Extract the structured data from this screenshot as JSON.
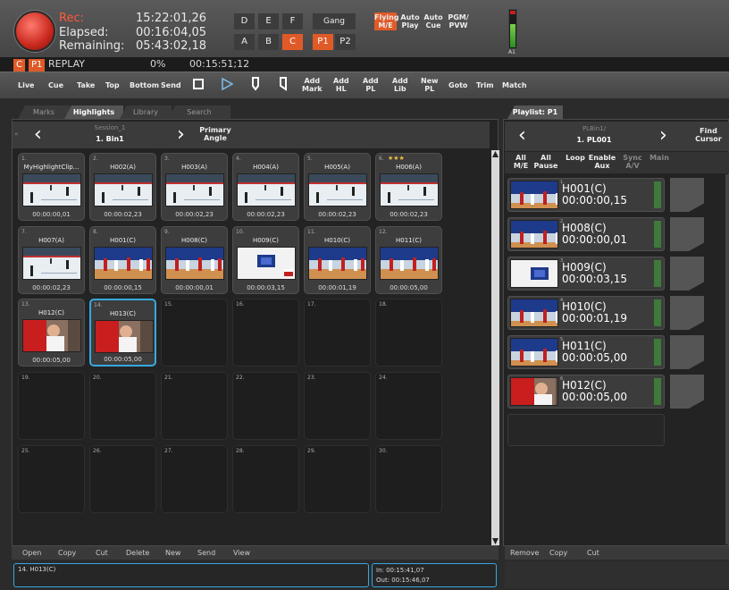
{
  "header": {
    "rec_label": "Rec:",
    "elapsed_label": "Elapsed:",
    "remaining_label": "Remaining:",
    "rec_time": "15:22:01,26",
    "elapsed_time": "00:16:04,05",
    "remaining_time": "05:43:02,18",
    "key_row1": [
      "D",
      "E",
      "F"
    ],
    "key_row2": [
      "A",
      "B",
      "C"
    ],
    "gang_label": "Gang",
    "p1_label": "P1",
    "p2_label": "P2",
    "flying_label_1": "Flying",
    "flying_label_2": "M/E",
    "auto_play_1": "Auto",
    "auto_play_2": "Play",
    "auto_cue_1": "Auto",
    "auto_cue_2": "Cue",
    "pgm_pvw_1": "PGM/",
    "pgm_pvw_2": "PVW",
    "meter_label": "A1"
  },
  "status": {
    "channel_tag": "C",
    "player_tag": "P1",
    "mode": "REPLAY",
    "percent": "0%",
    "timecode": "00:15:51;12"
  },
  "toolbar": {
    "live": "Live",
    "cue": "Cue",
    "take": "Take",
    "top": "Top",
    "bottom": "Bottom",
    "send": "Send",
    "add_mark_1": "Add",
    "add_mark_2": "Mark",
    "add_hl_1": "Add",
    "add_hl_2": "HL",
    "add_pl_1": "Add",
    "add_pl_2": "PL",
    "add_lib_1": "Add",
    "add_lib_2": "Lib",
    "new_pl_1": "New",
    "new_pl_2": "PL",
    "goto": "Goto",
    "trim": "Trim",
    "match": "Match"
  },
  "tabs": [
    "Marks",
    "Highlights",
    "Library",
    "Search"
  ],
  "bin": {
    "session_caption": "Session_1",
    "bin_name": "1. Bin1",
    "primary_1": "Primary",
    "primary_2": "Angle"
  },
  "clips": [
    {
      "num": "1.",
      "name": "MyHighlightClip...",
      "time": "00:00:00,01",
      "thumb": "hockey"
    },
    {
      "num": "2.",
      "name": "H002(A)",
      "time": "00:00:02,23",
      "thumb": "hockey"
    },
    {
      "num": "3.",
      "name": "H003(A)",
      "time": "00:00:02,23",
      "thumb": "hockey"
    },
    {
      "num": "4.",
      "name": "H004(A)",
      "time": "00:00:02,23",
      "thumb": "hockey"
    },
    {
      "num": "5.",
      "name": "H005(A)",
      "time": "00:00:02,23",
      "thumb": "hockey"
    },
    {
      "num": "6.",
      "name": "H006(A)",
      "time": "00:00:02,23",
      "thumb": "hockey",
      "stars": "★★★"
    },
    {
      "num": "7.",
      "name": "H007(A)",
      "time": "00:00:02,23",
      "thumb": "hockey"
    },
    {
      "num": "8.",
      "name": "H001(C)",
      "time": "00:00:00,15",
      "thumb": "basket"
    },
    {
      "num": "9.",
      "name": "H008(C)",
      "time": "00:00:00,01",
      "thumb": "basket"
    },
    {
      "num": "10.",
      "name": "H009(C)",
      "time": "00:00:03,15",
      "thumb": "board"
    },
    {
      "num": "11.",
      "name": "H010(C)",
      "time": "00:00:01,19",
      "thumb": "basket"
    },
    {
      "num": "12.",
      "name": "H011(C)",
      "time": "00:00:05,00",
      "thumb": "basket"
    },
    {
      "num": "13.",
      "name": "H012(C)",
      "time": "00:00:05,00",
      "thumb": "closeup"
    },
    {
      "num": "14.",
      "name": "H013(C)",
      "time": "00:00:05,00",
      "thumb": "closeup",
      "selected": true
    },
    {
      "num": "15."
    },
    {
      "num": "16."
    },
    {
      "num": "17."
    },
    {
      "num": "18."
    },
    {
      "num": "19."
    },
    {
      "num": "20."
    },
    {
      "num": "21."
    },
    {
      "num": "22."
    },
    {
      "num": "23."
    },
    {
      "num": "24."
    },
    {
      "num": "25."
    },
    {
      "num": "26."
    },
    {
      "num": "27."
    },
    {
      "num": "28."
    },
    {
      "num": "29."
    },
    {
      "num": "30."
    }
  ],
  "bottom_bar": [
    "Open",
    "Copy",
    "Cut",
    "Delete",
    "New",
    "Send",
    "View"
  ],
  "selection_info": "14. H013(C)",
  "in_point": "In:  00:15:41,07",
  "out_point": "Out: 00:15:46,07",
  "playlist": {
    "tab": "Playlist: P1",
    "caption": "PLBin1/",
    "name": "1. PL001",
    "find_1": "Find",
    "find_2": "Cursor",
    "tools": [
      {
        "a": "All",
        "b": "M/E"
      },
      {
        "a": "All",
        "b": "Pause"
      },
      {
        "a": "Loop",
        "b": ""
      },
      {
        "a": "Enable",
        "b": "Aux"
      },
      {
        "a": "Sync",
        "b": "A/V"
      },
      {
        "a": "Main",
        "b": ""
      }
    ],
    "items": [
      {
        "num": "1.",
        "name": "H001(C)",
        "time": "00:00:00,15",
        "thumb": "basket"
      },
      {
        "num": "2.",
        "name": "H008(C)",
        "time": "00:00:00,01",
        "thumb": "basket"
      },
      {
        "num": "3.",
        "name": "H009(C)",
        "time": "00:00:03,15",
        "thumb": "board"
      },
      {
        "num": "4.",
        "name": "H010(C)",
        "time": "00:00:01,19",
        "thumb": "basket"
      },
      {
        "num": "5.",
        "name": "H011(C)",
        "time": "00:00:05,00",
        "thumb": "basket"
      },
      {
        "num": "6.",
        "name": "H012(C)",
        "time": "00:00:05,00",
        "thumb": "closeup"
      }
    ],
    "bottom_bar": [
      "Remove",
      "Copy",
      "Cut"
    ]
  }
}
